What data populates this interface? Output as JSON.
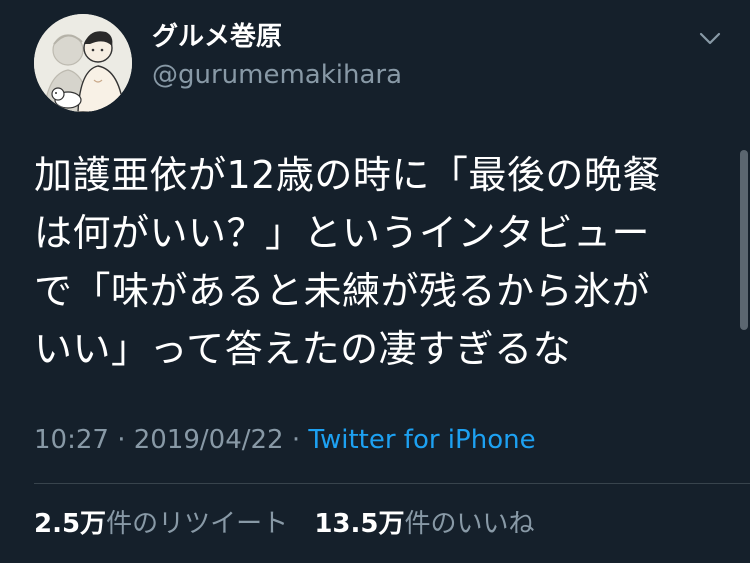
{
  "author": {
    "display_name": "グルメ巻原",
    "handle": "@gurumemakihara"
  },
  "tweet": {
    "lines": [
      "加護亜依が12歳の時に「最後の晩餐",
      "は何がいい？」というインタビュー",
      "で「味があると未練が残るから氷が",
      "いい」って答えたの凄すぎるな"
    ],
    "time": "10:27",
    "date": "2019/04/22",
    "separator": "·",
    "source": "Twitter for iPhone"
  },
  "stats": {
    "retweets_count": "2.5万",
    "retweets_label": "件のリツイート",
    "likes_count": "13.5万",
    "likes_label": "件のいいね"
  },
  "icons": {
    "caret": "chevron-down-icon",
    "avatar": "avatar"
  },
  "colors": {
    "background": "#15202b",
    "text": "#ffffff",
    "secondary": "#8899a6",
    "link": "#1da1f2",
    "divider": "#38444d"
  }
}
